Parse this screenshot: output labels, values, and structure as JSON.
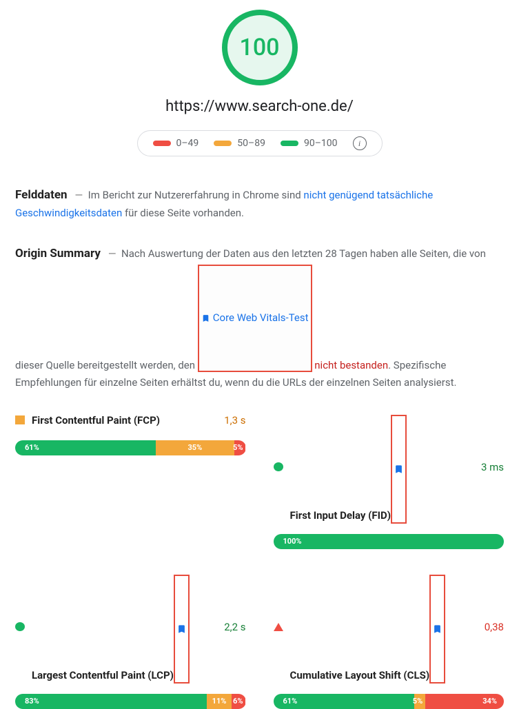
{
  "header": {
    "score": "100",
    "url": "https://www.search-one.de/",
    "legend": {
      "low": "0–49",
      "mid": "50–89",
      "high": "90–100"
    }
  },
  "felddaten": {
    "title": "Felddaten",
    "text_prefix": "Im Bericht zur Nutzererfahrung in Chrome sind",
    "link": "nicht genügend tatsächliche Geschwindigkeitsdaten",
    "text_suffix": "für diese Seite vorhanden."
  },
  "origin": {
    "title": "Origin Summary",
    "text_prefix": "Nach Auswertung der Daten aus den letzten 28 Tagen haben alle Seiten, die von dieser Quelle bereitgestellt werden, den",
    "cwv_label": "Core Web Vitals-Test",
    "fail_text": "nicht bestanden",
    "text_suffix": ". Spezifische Empfehlungen für einzelne Seiten erhältst du, wenn du die URLs der einzelnen Seiten analysierst."
  },
  "metrics": {
    "fcp": {
      "name": "First Contentful Paint (FCP)",
      "value": "1,3 s",
      "dist": {
        "g": 61,
        "o": 35,
        "r": 5,
        "g_lab": "61%",
        "o_lab": "35%",
        "r_lab": "5%"
      }
    },
    "fid": {
      "name": "First Input Delay (FID)",
      "value": "3 ms",
      "dist": {
        "g": 100,
        "g_lab": "100%"
      }
    },
    "lcp": {
      "name": "Largest Contentful Paint (LCP)",
      "value": "2,2 s",
      "dist": {
        "g": 83,
        "o": 11,
        "r": 6,
        "g_lab": "83%",
        "o_lab": "11%",
        "r_lab": "6%"
      }
    },
    "cls": {
      "name": "Cumulative Layout Shift (CLS)",
      "value": "0,38",
      "dist": {
        "g": 61,
        "o": 5,
        "r": 34,
        "g_lab": "61%",
        "o_lab": "5%",
        "r_lab": "34%"
      }
    }
  }
}
